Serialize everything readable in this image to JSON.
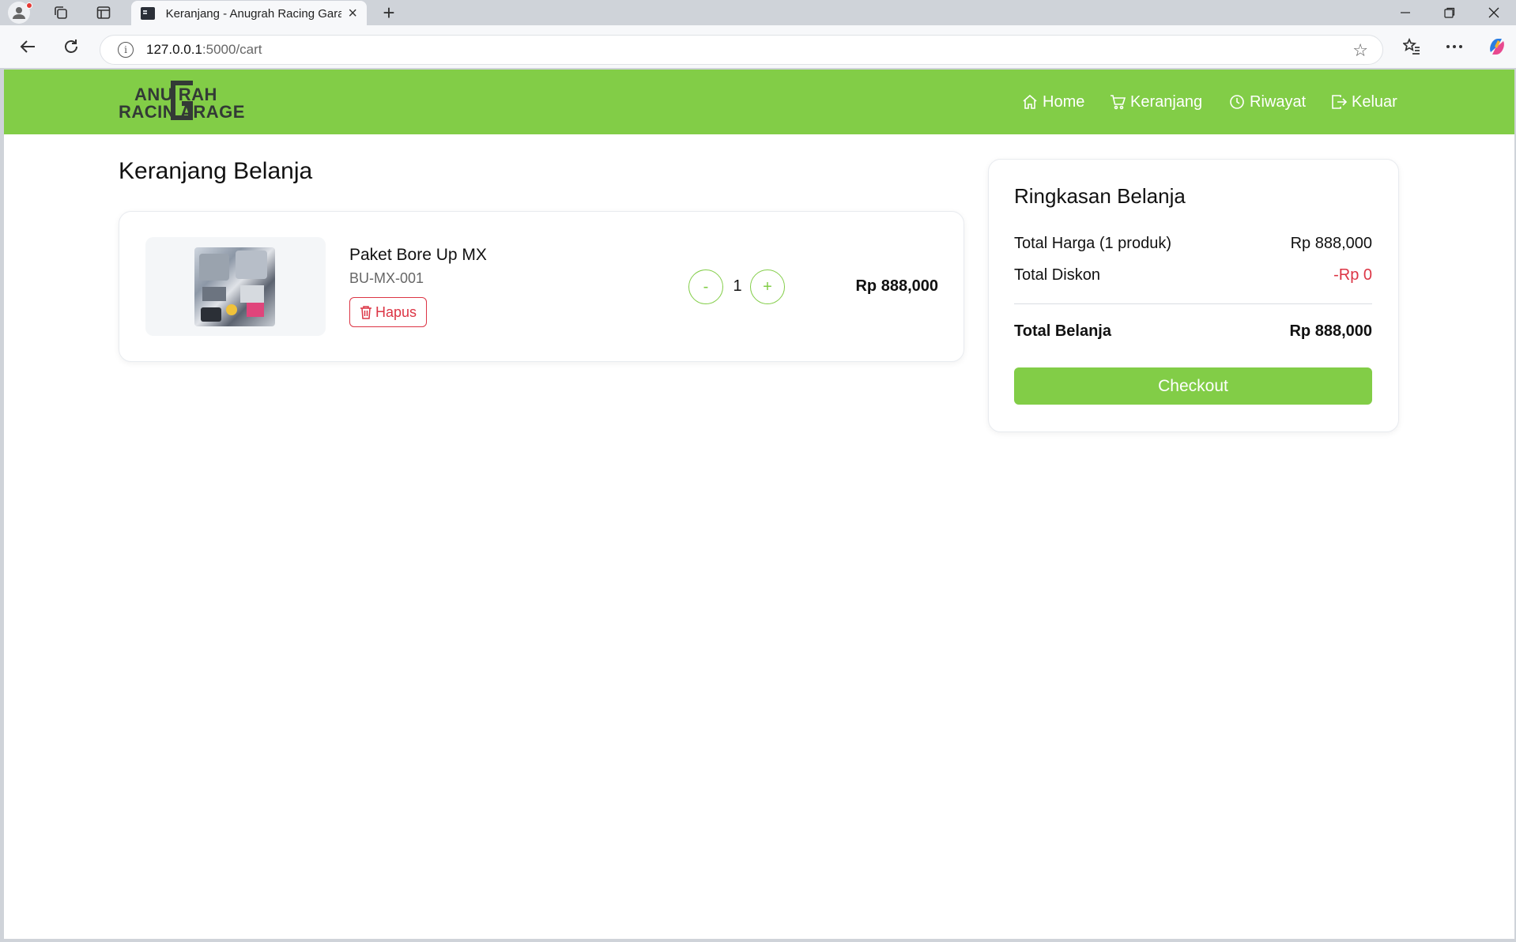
{
  "browser": {
    "tab_title": "Keranjang - Anugrah Racing Garage",
    "url_host": "127.0.0.1",
    "url_rest": ":5000/cart"
  },
  "logo": {
    "line1": "ANU  RAH",
    "line2": "RACIN  ARAGE"
  },
  "nav": {
    "home": "Home",
    "cart": "Keranjang",
    "history": "Riwayat",
    "logout": "Keluar"
  },
  "page_title": "Keranjang Belanja",
  "cart_items": [
    {
      "name": "Paket Bore Up MX",
      "sku": "BU-MX-001",
      "remove_label": "Hapus",
      "quantity": "1",
      "price": "Rp 888,000"
    }
  ],
  "qty_controls": {
    "minus": "-",
    "plus": "+"
  },
  "summary": {
    "title": "Ringkasan Belanja",
    "total_price_label": "Total Harga (1 produk)",
    "total_price_value": "Rp 888,000",
    "discount_label": "Total Diskon",
    "discount_value": "-Rp 0",
    "grand_total_label": "Total Belanja",
    "grand_total_value": "Rp 888,000",
    "checkout_label": "Checkout"
  },
  "colors": {
    "brand_green": "#82cd47",
    "danger_red": "#dc3545"
  }
}
